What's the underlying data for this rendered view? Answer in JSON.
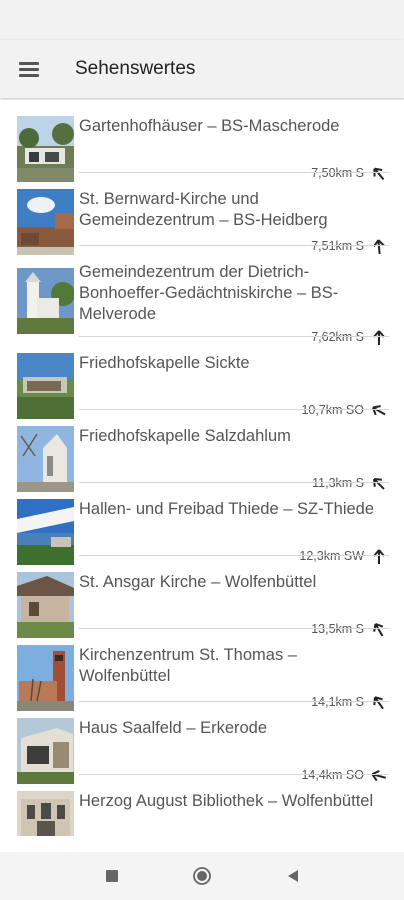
{
  "header": {
    "title": "Sehenswertes",
    "menu_icon": "hamburger-menu-icon"
  },
  "items": [
    {
      "name": "Gartenhofhäuser – BS-Mascherode",
      "distance": "7,50km S",
      "arrow_icon": "direction-arrow-icon"
    },
    {
      "name": "St. Bernward-Kirche und Gemeindezentrum – BS-Heidberg",
      "distance": "7,51km S",
      "arrow_icon": "direction-arrow-icon"
    },
    {
      "name": "Gemeindezentrum der Dietrich-Bonhoeffer-Gedächtniskirche – BS-Melverode",
      "distance": "7,62km S",
      "arrow_icon": "direction-arrow-icon"
    },
    {
      "name": "Friedhofskapelle Sickte",
      "distance": "10,7km SO",
      "arrow_icon": "direction-arrow-icon"
    },
    {
      "name": "Friedhofskapelle Salzdahlum",
      "distance": "11,3km S",
      "arrow_icon": "direction-arrow-icon"
    },
    {
      "name": "Hallen- und Freibad Thiede – SZ-Thiede",
      "distance": "12,3km SW",
      "arrow_icon": "direction-arrow-icon"
    },
    {
      "name": "St. Ansgar Kirche – Wolfenbüttel",
      "distance": "13,5km S",
      "arrow_icon": "direction-arrow-icon"
    },
    {
      "name": "Kirchenzentrum St. Thomas – Wolfenbüttel",
      "distance": "14,1km S",
      "arrow_icon": "direction-arrow-icon"
    },
    {
      "name": "Haus Saalfeld – Erkerode",
      "distance": "14,4km SO",
      "arrow_icon": "direction-arrow-icon"
    },
    {
      "name": "Herzog August Bibliothek – Wolfenbüttel",
      "distance": "",
      "arrow_icon": "direction-arrow-icon"
    }
  ],
  "navbar": {
    "recents_icon": "square-recents-icon",
    "home_icon": "circle-home-icon",
    "back_icon": "triangle-back-icon"
  },
  "colors": {
    "appbar": "#f2f2f2",
    "text": "#555555",
    "title": "#222222",
    "divider": "#d6d6d6"
  }
}
